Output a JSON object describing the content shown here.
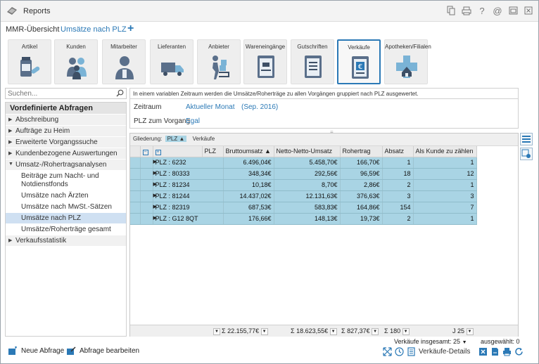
{
  "window": {
    "title": "Reports"
  },
  "tabs": [
    {
      "label": "MMR-Übersicht"
    },
    {
      "label": "Umsätze nach PLZ"
    }
  ],
  "tab_add": "+",
  "ribbon": [
    {
      "label": "Artikel"
    },
    {
      "label": "Kunden"
    },
    {
      "label": "Mitarbeiter"
    },
    {
      "label": "Lieferanten"
    },
    {
      "label": "Anbieter"
    },
    {
      "label": "Wareneingänge"
    },
    {
      "label": "Gutschriften"
    },
    {
      "label": "Verkäufe"
    },
    {
      "label": "Apotheken/Filialen"
    }
  ],
  "search": {
    "placeholder": "Suchen..."
  },
  "tree": {
    "header": "Vordefinierte Abfragen",
    "items": [
      {
        "label": "Abschreibung"
      },
      {
        "label": "Aufträge zu Heim"
      },
      {
        "label": "Erweiterte Vorgangssuche"
      },
      {
        "label": "Kundenbezogene Auswertungen"
      },
      {
        "label": "Umsatz-/Rohertragsanalysen"
      },
      {
        "label": "Beiträge zum Nacht- und Notdienstfonds"
      },
      {
        "label": "Umsätze nach Ärzten"
      },
      {
        "label": "Umsätze nach MwSt.-Sätzen"
      },
      {
        "label": "Umsätze nach PLZ"
      },
      {
        "label": "Umsätze/Roherträge gesamt"
      },
      {
        "label": "Verkaufsstatistik"
      }
    ]
  },
  "description": "In einem variablen Zeitraum werden die Umsätze/Roherträge zu allen Vorgängen gruppiert nach PLZ ausgewertet.",
  "params": {
    "zeitraum_label": "Zeitraum",
    "zeitraum_value": "Aktueller Monat",
    "zeitraum_range": "(Sep. 2016)",
    "plz_label": "PLZ zum Vorgang",
    "plz_value": "Egal"
  },
  "grouping": {
    "label": "Gliederung:",
    "chip": "PLZ",
    "secondary": "Verkäufe"
  },
  "grid": {
    "headers": [
      "PLZ",
      "Bruttoumsatz",
      "Netto-Netto-Umsatz",
      "Rohertrag",
      "Absatz",
      "Als Kunde zu zählen"
    ],
    "rows": [
      {
        "plz": "PLZ : 6232",
        "brutto": "6.496,04€",
        "netto": "5.458,70€",
        "roh": "166,70€",
        "absatz": "1",
        "kunde": "1"
      },
      {
        "plz": "PLZ : 80333",
        "brutto": "348,34€",
        "netto": "292,56€",
        "roh": "96,59€",
        "absatz": "18",
        "kunde": "12"
      },
      {
        "plz": "PLZ : 81234",
        "brutto": "10,18€",
        "netto": "8,70€",
        "roh": "2,86€",
        "absatz": "2",
        "kunde": "1"
      },
      {
        "plz": "PLZ : 81244",
        "brutto": "14.437,02€",
        "netto": "12.131,63€",
        "roh": "376,63€",
        "absatz": "3",
        "kunde": "3"
      },
      {
        "plz": "PLZ : 82319",
        "brutto": "687,53€",
        "netto": "583,83€",
        "roh": "164,86€",
        "absatz": "154",
        "kunde": "7"
      },
      {
        "plz": "PLZ : G12 8QT",
        "brutto": "176,66€",
        "netto": "148,13€",
        "roh": "19,73€",
        "absatz": "2",
        "kunde": "1"
      }
    ],
    "sums": {
      "brutto": "Σ 22.155,77€",
      "netto": "Σ 18.623,55€",
      "roh": "Σ 827,37€",
      "absatz": "Σ 180",
      "kunde": "J 25"
    }
  },
  "bottom": {
    "new_query": "Neue Abfrage",
    "edit_query": "Abfrage bearbeiten",
    "total": "Verkäufe insgesamt: 25",
    "selected": "ausgewählt: 0",
    "details": "Verkäufe-Details"
  },
  "colors": {
    "accent": "#2b79b6",
    "row_highlight": "#a9d4e4"
  }
}
